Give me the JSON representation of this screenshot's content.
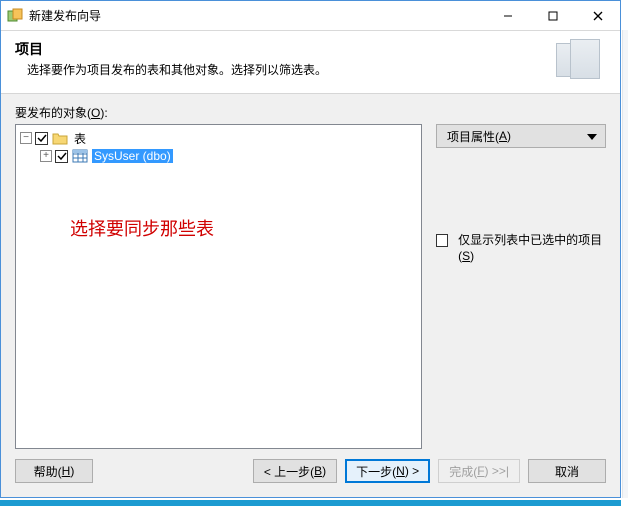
{
  "window": {
    "title": "新建发布向导"
  },
  "header": {
    "title": "项目",
    "desc": "选择要作为项目发布的表和其他对象。选择列以筛选表。"
  },
  "objects": {
    "label_prefix": "要发布的对象(",
    "label_hotkey": "O",
    "label_suffix": "):"
  },
  "tree": {
    "root": {
      "label": "表",
      "checked": true,
      "expanded": true
    },
    "items": [
      {
        "label": "SysUser (dbo)",
        "checked": true,
        "selected": true
      }
    ]
  },
  "annotation": {
    "text": "选择要同步那些表"
  },
  "side": {
    "properties_label": "项目属性(",
    "properties_hotkey": "A",
    "properties_suffix": ")",
    "show_selected_prefix": "仅显示列表中已选中的项目(",
    "show_selected_hotkey": "S",
    "show_selected_suffix": ")",
    "show_selected_checked": false
  },
  "footer": {
    "help_prefix": "帮助(",
    "help_hotkey": "H",
    "help_suffix": ")",
    "back_prefix": "< 上一步(",
    "back_hotkey": "B",
    "back_suffix": ")",
    "next_prefix": "下一步(",
    "next_hotkey": "N",
    "next_suffix": ") >",
    "finish_prefix": "完成(",
    "finish_hotkey": "F",
    "finish_suffix": ") >>|",
    "cancel": "取消"
  }
}
